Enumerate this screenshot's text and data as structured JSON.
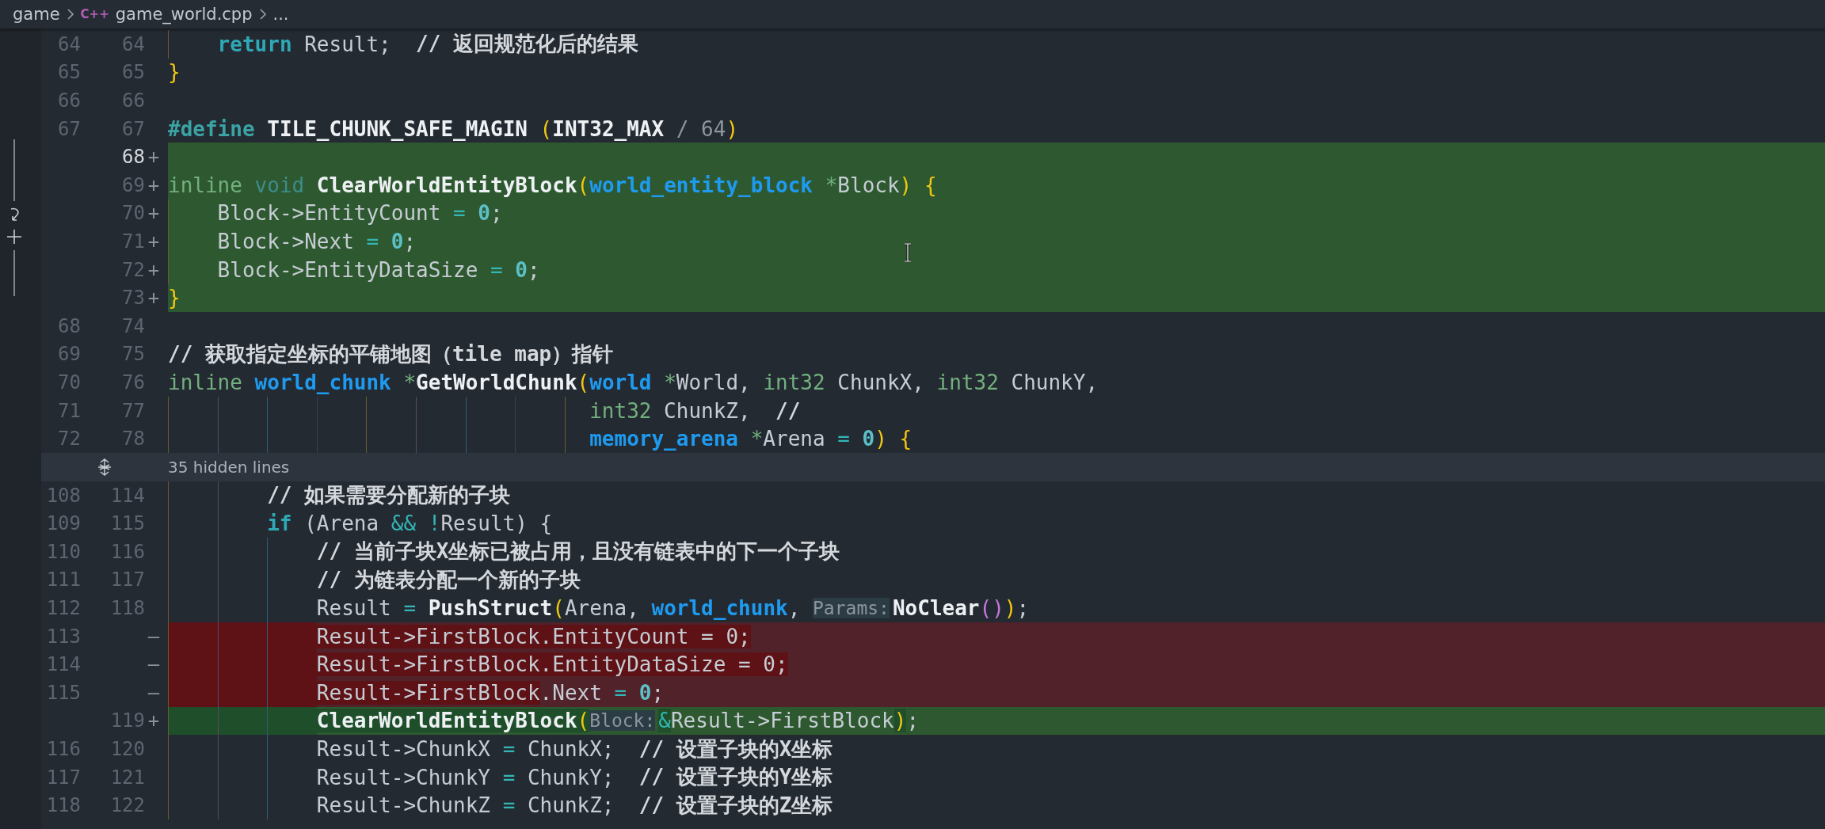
{
  "breadcrumb": [
    {
      "text": "game"
    },
    {
      "text": "game_world.cpp",
      "icon": "C++"
    },
    {
      "text": "..."
    }
  ],
  "lines": [
    {
      "kind": "context",
      "old": "64",
      "new": "64",
      "current": false,
      "tokens": [
        {
          "kind": "ctrl",
          "text": "    return"
        },
        {
          "kind": "text",
          "text": " Result;  "
        },
        {
          "kind": "comment",
          "text": "// 返回规范化后的结果"
        }
      ]
    },
    {
      "kind": "context",
      "old": "65",
      "new": "65",
      "current": false,
      "tokens": [
        {
          "kind": "paren",
          "text": "}"
        }
      ]
    },
    {
      "kind": "context",
      "old": "66",
      "new": "66",
      "current": false
    },
    {
      "kind": "context",
      "old": "67",
      "new": "67",
      "current": false,
      "tokens": [
        {
          "kind": "pre",
          "text": "#define"
        },
        {
          "kind": "macro",
          "text": " TILE_CHUNK_SAFE_MAGIN "
        },
        {
          "kind": "paren",
          "text": "("
        },
        {
          "kind": "macro",
          "text": "INT32_MAX"
        },
        {
          "kind": "dim",
          "text": " / 64"
        },
        {
          "kind": "paren",
          "text": ")"
        }
      ]
    },
    {
      "kind": "added",
      "new": "68",
      "marker": "+",
      "current": true
    },
    {
      "kind": "added",
      "new": "69",
      "marker": "+",
      "current": false,
      "tokens": [
        {
          "kind": "kw",
          "text": "inline "
        },
        {
          "kind": "kw2",
          "text": "void "
        },
        {
          "kind": "fn",
          "text": "ClearWorldEntityBlock"
        },
        {
          "kind": "paren",
          "text": "("
        },
        {
          "kind": "type",
          "text": "world_entity_block "
        },
        {
          "kind": "star",
          "text": "*"
        },
        {
          "kind": "text",
          "text": "Block"
        },
        {
          "kind": "paren",
          "text": ") {"
        }
      ]
    },
    {
      "kind": "added",
      "new": "70",
      "marker": "+",
      "current": false,
      "tokens": [
        {
          "kind": "text",
          "text": "    Block->EntityCount "
        },
        {
          "kind": "op",
          "text": "= "
        },
        {
          "kind": "num",
          "text": "0"
        },
        {
          "kind": "text",
          "text": ";"
        }
      ]
    },
    {
      "kind": "added",
      "new": "71",
      "marker": "+",
      "current": false,
      "tokens": [
        {
          "kind": "text",
          "text": "    Block->Next "
        },
        {
          "kind": "op",
          "text": "= "
        },
        {
          "kind": "num",
          "text": "0"
        },
        {
          "kind": "text",
          "text": ";"
        }
      ]
    },
    {
      "kind": "added",
      "new": "72",
      "marker": "+",
      "current": false,
      "tokens": [
        {
          "kind": "text",
          "text": "    Block->EntityDataSize "
        },
        {
          "kind": "op",
          "text": "= "
        },
        {
          "kind": "num",
          "text": "0"
        },
        {
          "kind": "text",
          "text": ";"
        }
      ]
    },
    {
      "kind": "added",
      "new": "73",
      "marker": "+",
      "current": false,
      "tokens": [
        {
          "kind": "paren",
          "text": "}"
        }
      ]
    },
    {
      "kind": "context",
      "old": "68",
      "new": "74",
      "current": false
    },
    {
      "kind": "context",
      "old": "69",
      "new": "75",
      "current": false,
      "tokens": [
        {
          "kind": "comment",
          "text": "// 获取指定坐标的平铺地图（tile map）指针"
        }
      ]
    },
    {
      "kind": "context",
      "old": "70",
      "new": "76",
      "current": false,
      "tokens": [
        {
          "kind": "kw",
          "text": "inline "
        },
        {
          "kind": "type",
          "text": "world_chunk "
        },
        {
          "kind": "star",
          "text": "*"
        },
        {
          "kind": "fn",
          "text": "GetWorldChunk"
        },
        {
          "kind": "paren",
          "text": "("
        },
        {
          "kind": "type",
          "text": "world "
        },
        {
          "kind": "star",
          "text": "*"
        },
        {
          "kind": "text",
          "text": "World, "
        },
        {
          "kind": "kw",
          "text": "int32"
        },
        {
          "kind": "text",
          "text": " ChunkX, "
        },
        {
          "kind": "kw",
          "text": "int32"
        },
        {
          "kind": "text",
          "text": " ChunkY,"
        }
      ]
    },
    {
      "kind": "context",
      "old": "71",
      "new": "77",
      "current": false,
      "tokens": [
        {
          "kind": "kw",
          "text": "                                  int32"
        },
        {
          "kind": "text",
          "text": " ChunkZ,  "
        },
        {
          "kind": "comment",
          "text": "//"
        }
      ]
    },
    {
      "kind": "context",
      "old": "72",
      "new": "78",
      "current": false,
      "tokens": [
        {
          "kind": "type",
          "text": "                                  memory_arena "
        },
        {
          "kind": "star",
          "text": "*"
        },
        {
          "kind": "text",
          "text": "Arena "
        },
        {
          "kind": "op",
          "text": "= "
        },
        {
          "kind": "num",
          "text": "0"
        },
        {
          "kind": "paren",
          "text": ") {"
        }
      ]
    },
    {
      "kind": "fold",
      "label": "35 hidden lines"
    },
    {
      "kind": "context",
      "old": "108",
      "new": "114",
      "current": false,
      "tokens": [
        {
          "kind": "comment",
          "text": "        // 如果需要分配新的子块"
        }
      ]
    },
    {
      "kind": "context",
      "old": "109",
      "new": "115",
      "current": false,
      "tokens": [
        {
          "kind": "ctrl",
          "text": "        if"
        },
        {
          "kind": "text",
          "text": " (Arena "
        },
        {
          "kind": "op",
          "text": "&& !"
        },
        {
          "kind": "text",
          "text": "Result) {"
        }
      ]
    },
    {
      "kind": "context",
      "old": "110",
      "new": "116",
      "current": false,
      "tokens": [
        {
          "kind": "comment",
          "text": "            // 当前子块X坐标已被占用，且没有链表中的下一个子块"
        }
      ]
    },
    {
      "kind": "context",
      "old": "111",
      "new": "117",
      "current": false,
      "tokens": [
        {
          "kind": "comment",
          "text": "            // 为链表分配一个新的子块"
        }
      ]
    },
    {
      "kind": "context",
      "old": "112",
      "new": "118",
      "current": false,
      "tokens": [
        {
          "kind": "text",
          "text": "            Result "
        },
        {
          "kind": "op",
          "text": "= "
        },
        {
          "kind": "fn",
          "text": "PushStruct"
        },
        {
          "kind": "paren",
          "text": "("
        },
        {
          "kind": "text",
          "text": "Arena, "
        },
        {
          "kind": "type",
          "text": "world_chunk"
        },
        {
          "kind": "text",
          "text": ", "
        },
        {
          "kind": "hint",
          "text": "Params:"
        },
        {
          "kind": "fn",
          "text": "NoClear"
        },
        {
          "kind": "paren2",
          "text": "()"
        },
        {
          "kind": "paren",
          "text": ")"
        },
        {
          "kind": "text",
          "text": ";"
        }
      ]
    },
    {
      "kind": "removed",
      "old": "113",
      "marker": "—",
      "current": false,
      "tokens": [
        {
          "kind": "text",
          "text": "            Result->FirstBlock.EntityCount = 0;",
          "changed": true
        }
      ]
    },
    {
      "kind": "removed",
      "old": "114",
      "marker": "—",
      "current": false,
      "tokens": [
        {
          "kind": "text",
          "text": "            Result->FirstBlock.EntityDataSize = 0;",
          "changed": true
        }
      ]
    },
    {
      "kind": "removed",
      "old": "115",
      "marker": "—",
      "current": false,
      "tokens": [
        {
          "kind": "text",
          "text": "            Result->FirstBlock",
          "changed": true
        },
        {
          "kind": "text",
          "text": ".Next "
        },
        {
          "kind": "op",
          "text": "= "
        },
        {
          "kind": "num",
          "text": "0"
        },
        {
          "kind": "text",
          "text": ";"
        }
      ]
    },
    {
      "kind": "added",
      "new": "119",
      "marker": "+",
      "current": false,
      "tokens": [
        {
          "kind": "fn",
          "text": "            ClearWorldEntityBlock",
          "changed": true
        },
        {
          "kind": "paren",
          "text": "(",
          "changed": true
        },
        {
          "kind": "hint",
          "text": "Block:"
        },
        {
          "kind": "op",
          "text": "&",
          "changed": true
        },
        {
          "kind": "text",
          "text": "Result->FirstBlock"
        },
        {
          "kind": "paren",
          "text": ")",
          "changed": true
        },
        {
          "kind": "text",
          "text": ";"
        }
      ]
    },
    {
      "kind": "context",
      "old": "116",
      "new": "120",
      "current": false,
      "tokens": [
        {
          "kind": "text",
          "text": "            Result->ChunkX "
        },
        {
          "kind": "op",
          "text": "="
        },
        {
          "kind": "text",
          "text": " ChunkX;  "
        },
        {
          "kind": "comment",
          "text": "// 设置子块的X坐标"
        }
      ]
    },
    {
      "kind": "context",
      "old": "117",
      "new": "121",
      "current": false,
      "tokens": [
        {
          "kind": "text",
          "text": "            Result->ChunkY "
        },
        {
          "kind": "op",
          "text": "="
        },
        {
          "kind": "text",
          "text": " ChunkY;  "
        },
        {
          "kind": "comment",
          "text": "// 设置子块的Y坐标"
        }
      ]
    },
    {
      "kind": "context",
      "old": "118",
      "new": "122",
      "current": false,
      "tokens": [
        {
          "kind": "text",
          "text": "            Result->ChunkZ "
        },
        {
          "kind": "op",
          "text": "="
        },
        {
          "kind": "text",
          "text": " ChunkZ;  "
        },
        {
          "kind": "comment",
          "text": "// 设置子块的Z坐标"
        }
      ]
    }
  ]
}
